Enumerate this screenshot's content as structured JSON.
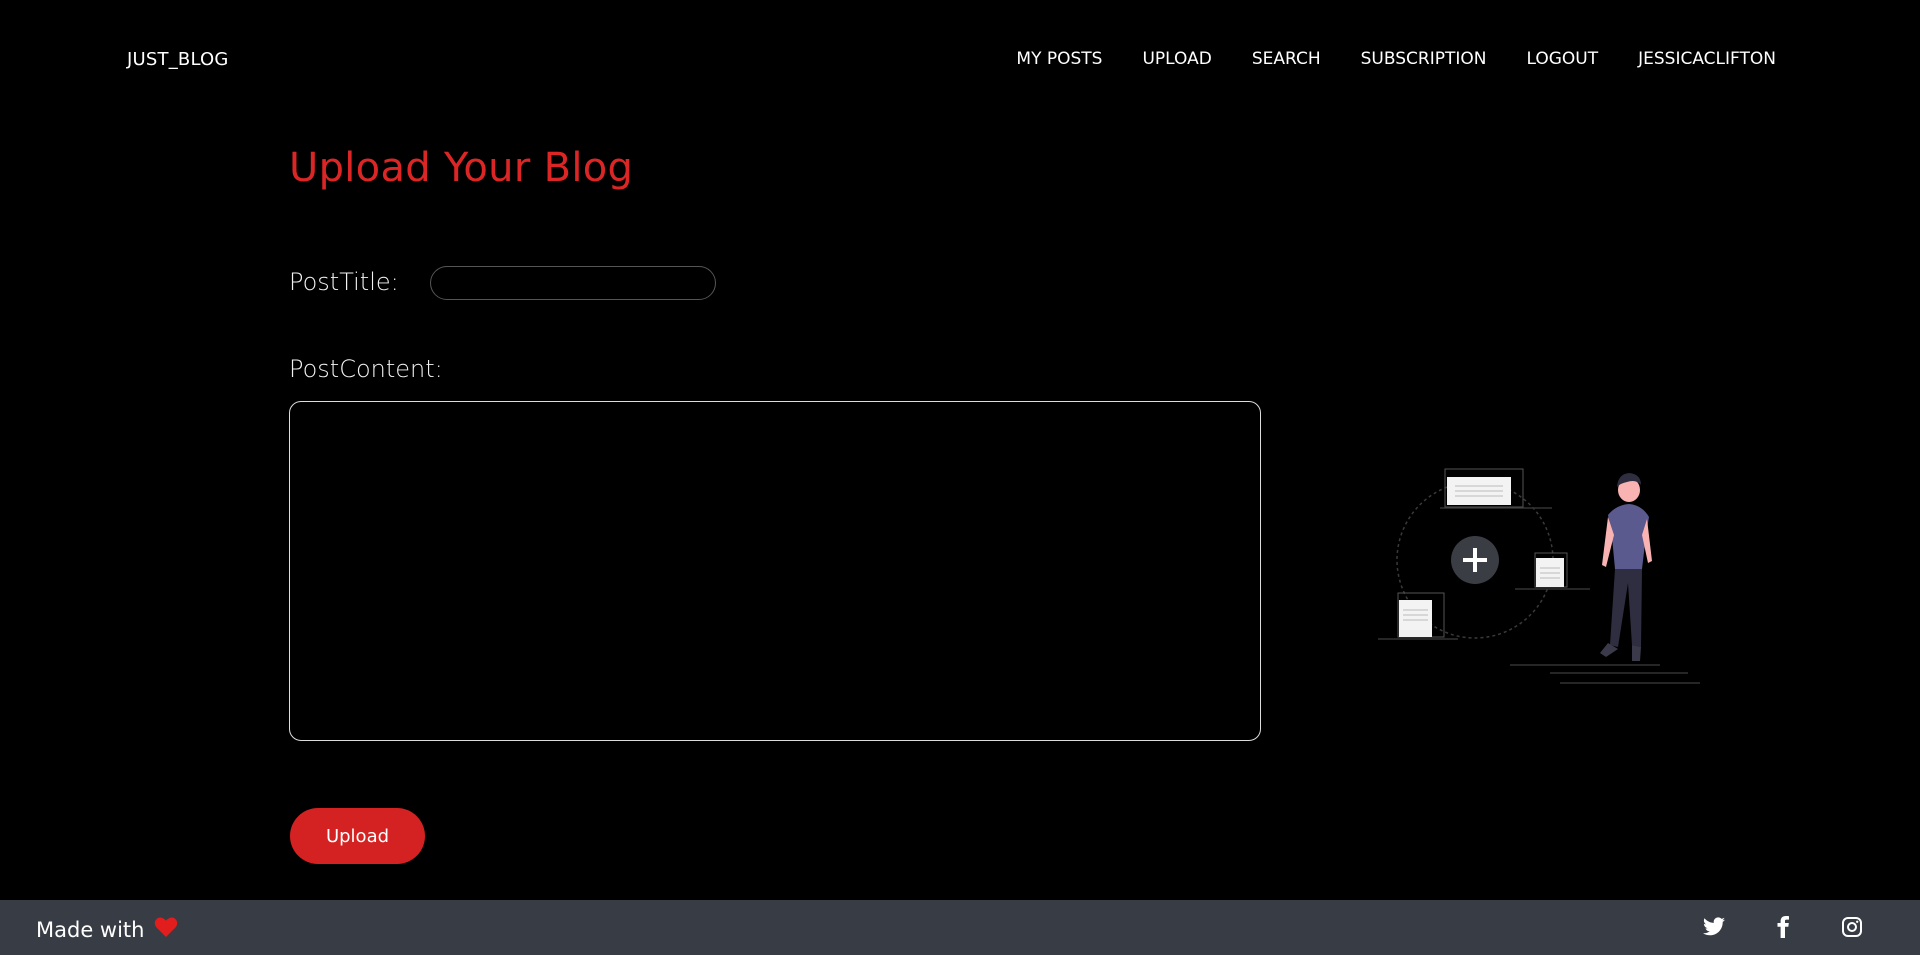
{
  "navbar": {
    "brand": "JUST_BLOG",
    "links": [
      {
        "label": "MY POSTS"
      },
      {
        "label": "UPLOAD"
      },
      {
        "label": "SEARCH"
      },
      {
        "label": "SUBSCRIPTION"
      },
      {
        "label": "LOGOUT"
      },
      {
        "label": "JESSICACLIFTON"
      }
    ]
  },
  "form": {
    "heading": "Upload Your Blog",
    "title_label": "PostTitle:",
    "title_value": "",
    "content_label": "PostContent:",
    "content_value": "",
    "submit_label": "Upload"
  },
  "illustration": {
    "icon": "add-files-person-illustration"
  },
  "footer": {
    "made_with": "Made with",
    "heart_icon": "heart-icon",
    "social": [
      {
        "icon": "twitter-icon"
      },
      {
        "icon": "facebook-icon"
      },
      {
        "icon": "instagram-icon"
      }
    ]
  },
  "colors": {
    "accent": "#dc2626",
    "background": "#000000",
    "footer": "#383c44"
  }
}
